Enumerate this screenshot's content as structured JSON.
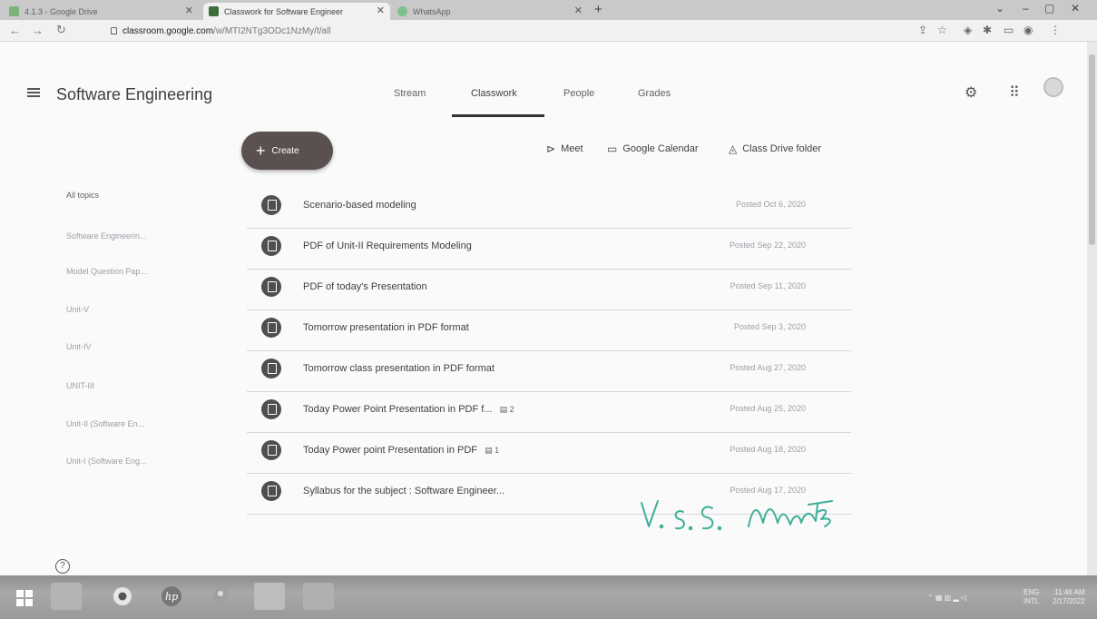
{
  "browser": {
    "tabs": [
      {
        "label": "4.1.3 - Google Drive",
        "active": false
      },
      {
        "label": "Classwork for Software Engineer",
        "active": true
      },
      {
        "label": "WhatsApp",
        "active": false
      }
    ],
    "new_tab": "+",
    "url_host": "classroom.google.com",
    "url_path": "/w/MTI2NTg3ODc1NzMy/t/all"
  },
  "header": {
    "class_name": "Software Engineering",
    "tabs": [
      "Stream",
      "Classwork",
      "People",
      "Grades"
    ],
    "selected_tab": "Classwork"
  },
  "toolbar": {
    "create_label": "Create",
    "links": [
      "Meet",
      "Google Calendar",
      "Class Drive folder"
    ]
  },
  "topics": [
    "All topics",
    "Software Engineerin...",
    "Model Question Pap...",
    "Unit-V",
    "Unit-IV",
    "UNIT-III",
    "Unit-II (Software En...",
    "Unit-I (Software Eng..."
  ],
  "items": [
    {
      "title": "Scenario-based modeling",
      "comments": "",
      "posted": "Posted Oct 6, 2020"
    },
    {
      "title": "PDF of Unit-II Requirements Modeling",
      "comments": "",
      "posted": "Posted Sep 22, 2020"
    },
    {
      "title": "PDF of today's Presentation",
      "comments": "",
      "posted": "Posted Sep 11, 2020"
    },
    {
      "title": "Tomorrow presentation in PDF format",
      "comments": "",
      "posted": "Posted Sep 3, 2020"
    },
    {
      "title": "Tomorrow class presentation in PDF format",
      "comments": "",
      "posted": "Posted Aug 27, 2020"
    },
    {
      "title": "Today Power Point Presentation in PDF f...",
      "comments": "2",
      "posted": "Posted Aug 25, 2020"
    },
    {
      "title": "Today Power point Presentation in PDF",
      "comments": "1",
      "posted": "Posted Aug 18, 2020"
    },
    {
      "title": "Syllabus for the subject : Software Engineer...",
      "comments": "",
      "posted": "Posted Aug 17, 2020"
    }
  ],
  "signature_text": "V. S. S. Murty",
  "taskbar": {
    "lang": "ENG",
    "lang2": "INTL",
    "time": "11:46 AM",
    "date": "2/17/2022"
  },
  "colors": {
    "create_button": "#5a5050",
    "signature_ink": "#3fae9a",
    "item_badge": "#4f4f4f"
  }
}
